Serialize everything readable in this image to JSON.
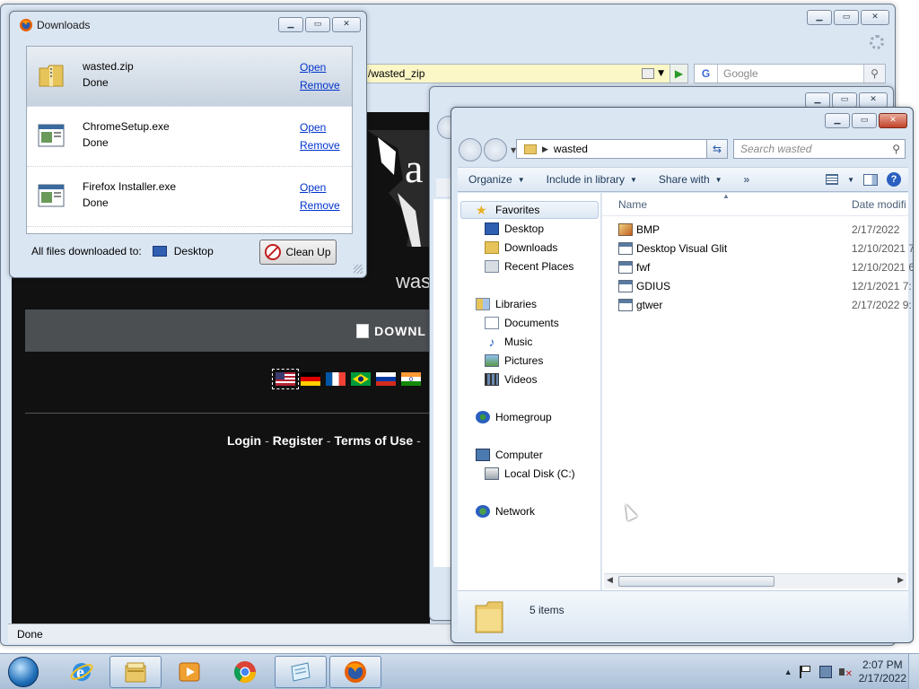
{
  "browser": {
    "url": "/wasted_zip",
    "search_placeholder": "Google",
    "search_engine_badge": "G",
    "status": "Done",
    "site": {
      "heading_partial": "a",
      "wasted_partial": "was",
      "download_partial": "DOWNL",
      "links": [
        "Login",
        "Register",
        "Terms of Use"
      ]
    }
  },
  "downloads": {
    "title": "Downloads",
    "items": [
      {
        "name": "wasted.zip",
        "status": "Done",
        "open": "Open",
        "remove": "Remove",
        "icon": "zip-folder-icon"
      },
      {
        "name": "ChromeSetup.exe",
        "status": "Done",
        "open": "Open",
        "remove": "Remove",
        "icon": "exe-app-icon"
      },
      {
        "name": "Firefox Installer.exe",
        "status": "Done",
        "open": "Open",
        "remove": "Remove",
        "icon": "exe-app-icon"
      }
    ],
    "footer_label": "All files downloaded to:",
    "footer_location": "Desktop",
    "cleanup_label": "Clean Up"
  },
  "explorer": {
    "address": "wasted",
    "search_placeholder": "Search wasted",
    "toolbar": {
      "organize": "Organize",
      "include": "Include in library",
      "share": "Share with",
      "more": "»"
    },
    "nav": {
      "favorites": "Favorites",
      "desktop": "Desktop",
      "downloads": "Downloads",
      "recent": "Recent Places",
      "libraries": "Libraries",
      "documents": "Documents",
      "music": "Music",
      "pictures": "Pictures",
      "videos": "Videos",
      "homegroup": "Homegroup",
      "computer": "Computer",
      "localdisk": "Local Disk (C:)",
      "network": "Network"
    },
    "columns": {
      "name": "Name",
      "date": "Date modifi"
    },
    "files": [
      {
        "name": "BMP",
        "date": "2/17/2022",
        "icon": "image-file-icon"
      },
      {
        "name": "Desktop Visual Glit",
        "date": "12/10/2021 7",
        "icon": "exe-file-icon"
      },
      {
        "name": "fwf",
        "date": "12/10/2021 6",
        "icon": "exe-file-icon"
      },
      {
        "name": "GDIUS",
        "date": "12/1/2021 7:",
        "icon": "exe-file-icon"
      },
      {
        "name": "gtwer",
        "date": "2/17/2022 9:",
        "icon": "exe-file-icon"
      }
    ],
    "item_count": "5 items"
  },
  "taskbar": {
    "time": "2:07 PM",
    "date": "2/17/2022",
    "apps": [
      "internet-explorer-icon",
      "file-explorer-icon",
      "media-player-icon",
      "chrome-icon",
      "notepad-icon",
      "firefox-icon"
    ]
  }
}
